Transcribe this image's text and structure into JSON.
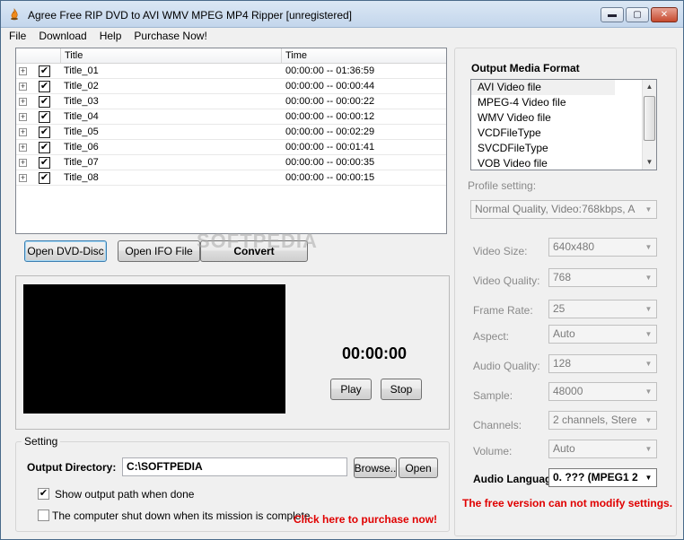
{
  "window": {
    "title": "Agree Free RIP DVD to AVI WMV MPEG MP4 Ripper  [unregistered]",
    "minimize": "▬",
    "maximize": "▢",
    "close": "✕"
  },
  "menu": [
    "File",
    "Download",
    "Help",
    "Purchase Now!"
  ],
  "title_list": {
    "headers": [
      "",
      "Title",
      "Time"
    ],
    "rows": [
      {
        "name": "Title_01",
        "time": "00:00:00 -- 01:36:59",
        "checked": true
      },
      {
        "name": "Title_02",
        "time": "00:00:00 -- 00:00:44",
        "checked": true
      },
      {
        "name": "Title_03",
        "time": "00:00:00 -- 00:00:22",
        "checked": true
      },
      {
        "name": "Title_04",
        "time": "00:00:00 -- 00:00:12",
        "checked": true
      },
      {
        "name": "Title_05",
        "time": "00:00:00 -- 00:02:29",
        "checked": true
      },
      {
        "name": "Title_06",
        "time": "00:00:00 -- 00:01:41",
        "checked": true
      },
      {
        "name": "Title_07",
        "time": "00:00:00 -- 00:00:35",
        "checked": true
      },
      {
        "name": "Title_08",
        "time": "00:00:00 -- 00:00:15",
        "checked": true
      }
    ]
  },
  "actions": {
    "open_dvd": "Open DVD-Disc",
    "open_ifo": "Open IFO File",
    "convert": "Convert"
  },
  "watermark": "SOFTPEDIA",
  "player": {
    "timer": "00:00:00",
    "play": "Play",
    "stop": "Stop"
  },
  "setting": {
    "legend": "Setting",
    "output_dir_label": "Output Directory:",
    "output_dir_value": "C:\\SOFTPEDIA",
    "browse": "Browse..",
    "open": "Open",
    "show_path_label": "Show output path when done",
    "show_path_checked": true,
    "shutdown_label": "The computer shut down when its mission is complete",
    "shutdown_checked": false,
    "purchase_link": "Click here to purchase now!"
  },
  "format_panel": {
    "title": "Output Media Format",
    "formats": [
      "AVI Video file",
      "MPEG-4 Video file",
      "WMV Video file",
      "VCDFileType",
      "SVCDFileType",
      "VOB Video file"
    ],
    "selected_index": 0,
    "profile_label": "Profile setting:",
    "profile_value": "Normal Quality, Video:768kbps, A",
    "fields": [
      {
        "label": "Video Size:",
        "value": "640x480"
      },
      {
        "label": "Video Quality:",
        "value": "768"
      },
      {
        "label": "Frame Rate:",
        "value": "25"
      },
      {
        "label": "Aspect:",
        "value": "Auto"
      },
      {
        "label": "Audio Quality:",
        "value": "128"
      },
      {
        "label": "Sample:",
        "value": "48000"
      },
      {
        "label": "Channels:",
        "value": "2 channels, Stere"
      },
      {
        "label": "Volume:",
        "value": "Auto"
      }
    ],
    "audio_language_label": "Audio Languag",
    "audio_language_value": "0. ??? (MPEG1 2",
    "warning": "The free version can not modify settings."
  },
  "colors": {
    "warning_red": "#e00000",
    "titlebar": "#c3d6ec"
  }
}
